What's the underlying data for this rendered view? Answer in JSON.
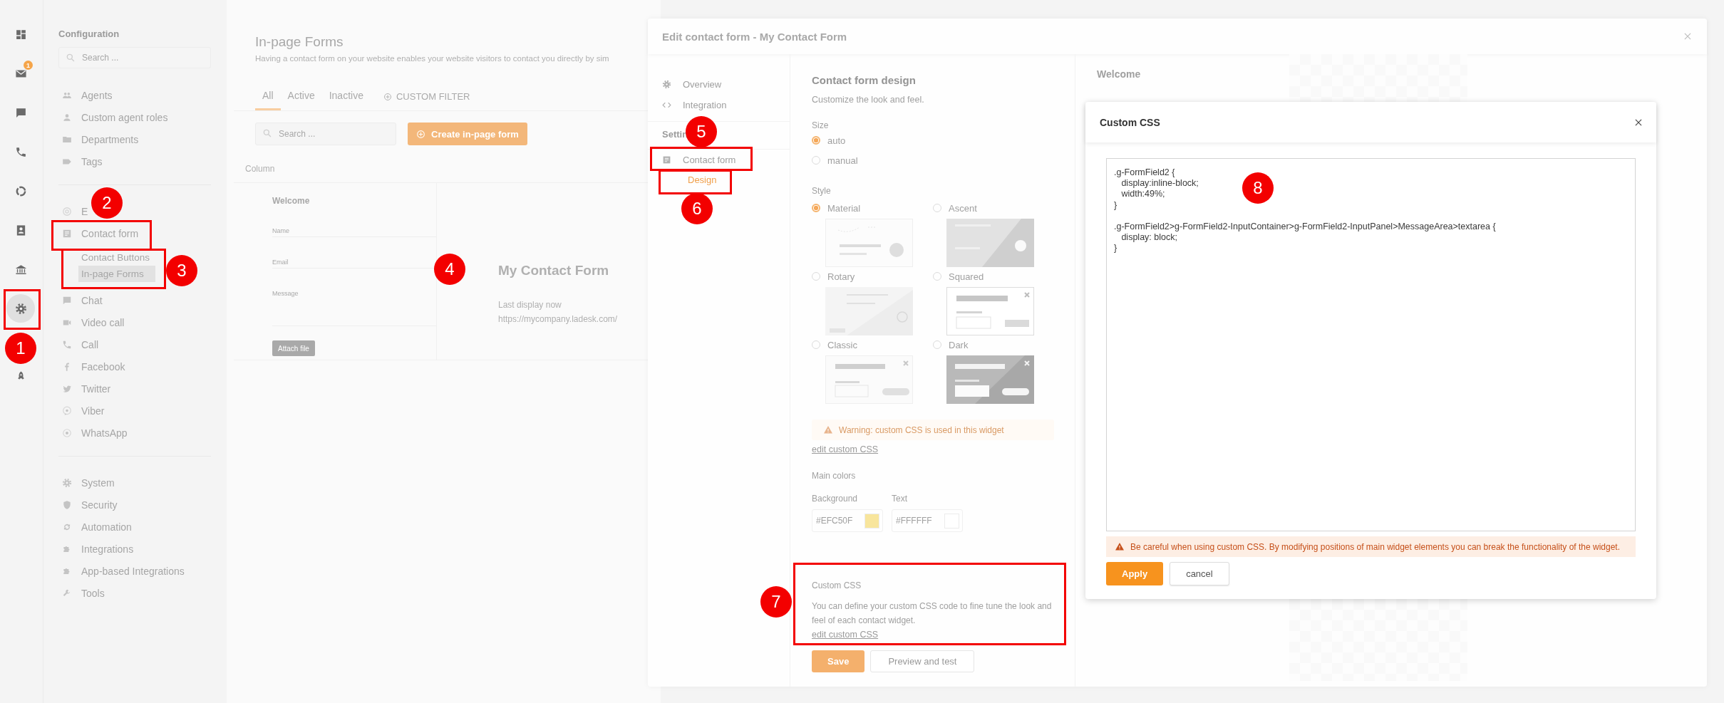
{
  "rail": {
    "items": [
      {
        "kind": "dashboard",
        "selected": false
      },
      {
        "kind": "mail",
        "selected": false,
        "badge": "1"
      },
      {
        "kind": "chat",
        "selected": false
      },
      {
        "kind": "phone",
        "selected": false
      },
      {
        "kind": "donut",
        "selected": false
      },
      {
        "kind": "contact",
        "selected": false
      },
      {
        "kind": "bank",
        "selected": false
      },
      {
        "kind": "gear",
        "selected": true
      },
      {
        "kind": "rocket",
        "selected": false
      }
    ]
  },
  "config": {
    "title": "Configuration",
    "search": {
      "placeholder": "Search ..."
    },
    "groups": [
      [
        {
          "kind": "people",
          "label": "Agents"
        },
        {
          "kind": "person",
          "label": "Custom agent roles"
        },
        {
          "kind": "folder",
          "label": "Departments"
        },
        {
          "kind": "tag",
          "label": "Tags"
        }
      ],
      [
        {
          "kind": "at",
          "label": "E"
        },
        {
          "kind": "form",
          "label": "Contact form",
          "children": [
            {
              "label": "Contact Buttons",
              "selected": false
            },
            {
              "label": "In-page Forms",
              "selected": true
            }
          ]
        },
        {
          "kind": "chat",
          "label": "Chat"
        },
        {
          "kind": "video",
          "label": "Video call"
        },
        {
          "kind": "phone",
          "label": "Call"
        },
        {
          "kind": "facebook",
          "label": "Facebook"
        },
        {
          "kind": "twitter",
          "label": "Twitter"
        },
        {
          "kind": "viber",
          "label": "Viber"
        },
        {
          "kind": "whatsapp",
          "label": "WhatsApp"
        }
      ],
      [
        {
          "kind": "gear",
          "label": "System"
        },
        {
          "kind": "shield",
          "label": "Security"
        },
        {
          "kind": "refresh",
          "label": "Automation"
        },
        {
          "kind": "puzzle",
          "label": "Integrations"
        },
        {
          "kind": "puzzle",
          "label": "App-based Integrations"
        },
        {
          "kind": "wrench",
          "label": "Tools"
        }
      ]
    ]
  },
  "page": {
    "title": "In-page Forms",
    "description": "Having a contact form on your website enables your website visitors to contact you directly by sim",
    "tabs": [
      {
        "label": "All",
        "selected": true
      },
      {
        "label": "Active",
        "selected": false
      },
      {
        "label": "Inactive",
        "selected": false
      }
    ],
    "custom_filter": "CUSTOM FILTER",
    "search": {
      "placeholder": "Search ..."
    },
    "create_button": "Create in-page form",
    "column_header": "Column",
    "card": {
      "form_title": "Welcome",
      "fields": [
        "Name",
        "Email",
        "Message"
      ],
      "attach_button": "Attach file",
      "name": "My Contact Form",
      "last_display": "Last display now",
      "url": "https://mycompany.ladesk.com/"
    }
  },
  "modal": {
    "title": "Edit contact form - My Contact Form",
    "nav": [
      {
        "kind": "gear",
        "label": "Overview"
      },
      {
        "kind": "code",
        "label": "Integration"
      }
    ],
    "section": "Settin",
    "settings": [
      {
        "kind": "form",
        "label": "Contact form",
        "children": [
          {
            "label": "Design",
            "selected": true
          }
        ]
      }
    ],
    "design": {
      "heading": "Contact form design",
      "subtitle": "Customize the look and feel.",
      "size": {
        "label": "Size",
        "options": [
          {
            "label": "auto",
            "selected": true
          },
          {
            "label": "manual",
            "selected": false
          }
        ]
      },
      "style": {
        "label": "Style",
        "options": [
          {
            "label": "Material",
            "kind": "material",
            "selected": true
          },
          {
            "label": "Ascent",
            "kind": "ascent",
            "selected": false
          },
          {
            "label": "Rotary",
            "kind": "rotary",
            "selected": false
          },
          {
            "label": "Squared",
            "kind": "squared",
            "selected": false
          },
          {
            "label": "Classic",
            "kind": "classic",
            "selected": false
          },
          {
            "label": "Dark",
            "kind": "dark",
            "selected": false
          }
        ]
      },
      "warning": "Warning: custom CSS is used in this widget",
      "warning_link": "edit custom CSS",
      "main_colors": {
        "label": "Main colors",
        "colors": [
          {
            "label": "Background",
            "value": "#EFC50F",
            "color": "#f8e59c"
          },
          {
            "label": "Text",
            "value": "#FFFFFF",
            "color": "#ffffff"
          }
        ]
      },
      "custom_css": {
        "label": "Custom CSS",
        "description": "You can define your custom CSS code to fine tune the look and feel of each contact widget.",
        "link": "edit custom CSS"
      },
      "buttons": [
        {
          "label": "Save",
          "kind": "primary"
        },
        {
          "label": "Preview and test",
          "kind": "secondary"
        }
      ]
    },
    "preview": {
      "title": "Welcome"
    }
  },
  "css_dialog": {
    "title": "Custom CSS",
    "code": ".g-FormField2 {\n   display:inline-block;\n   width:49%;\n}\n\n.g-FormField2>g-FormField2-InputContainer>g-FormField2-InputPanel>MessageArea>textarea {\n   display: block;\n}",
    "warning": "Be careful when using custom CSS. By modifying positions of main widget elements you can break the functionality of the widget.",
    "buttons": [
      {
        "label": "Apply",
        "kind": "primary"
      },
      {
        "label": "cancel",
        "kind": "secondary"
      }
    ]
  },
  "callouts": [
    {
      "number": "1",
      "boxed": true
    },
    {
      "number": "2",
      "boxed": true
    },
    {
      "number": "3",
      "boxed": true
    },
    {
      "number": "4",
      "boxed": false
    },
    {
      "number": "5",
      "boxed": true
    },
    {
      "number": "6",
      "boxed": true
    },
    {
      "number": "7",
      "boxed": true
    },
    {
      "number": "8",
      "boxed": false
    }
  ]
}
